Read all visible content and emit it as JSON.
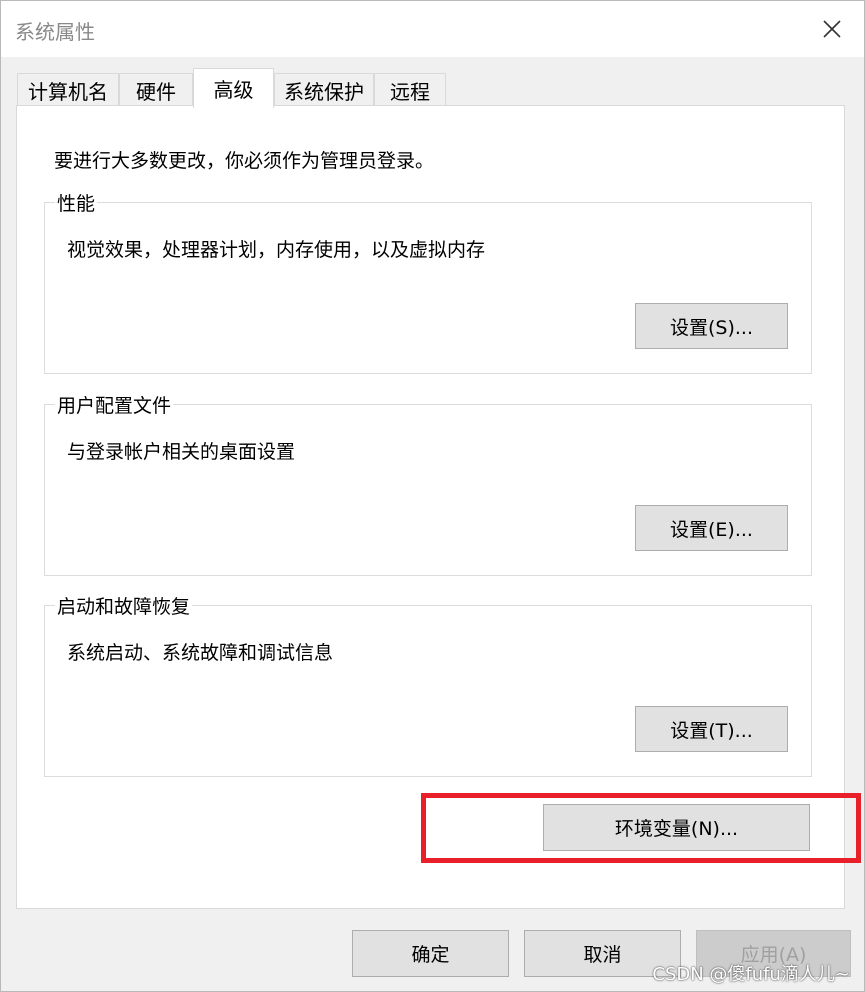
{
  "window": {
    "title": "系统属性"
  },
  "tabs": [
    {
      "label": "计算机名"
    },
    {
      "label": "硬件"
    },
    {
      "label": "高级"
    },
    {
      "label": "系统保护"
    },
    {
      "label": "远程"
    }
  ],
  "active_tab": "高级",
  "advanced": {
    "admin_note": "要进行大多数更改，你必须作为管理员登录。",
    "performance": {
      "title": "性能",
      "description": "视觉效果，处理器计划，内存使用，以及虚拟内存",
      "button": "设置(S)..."
    },
    "user_profiles": {
      "title": "用户配置文件",
      "description": "与登录帐户相关的桌面设置",
      "button": "设置(E)..."
    },
    "startup_recovery": {
      "title": "启动和故障恢复",
      "description": "系统启动、系统故障和调试信息",
      "button": "设置(T)..."
    },
    "env_button": "环境变量(N)..."
  },
  "footer": {
    "ok": "确定",
    "cancel": "取消",
    "apply": "应用(A)"
  },
  "watermark": "CSDN @傻fufu滴人儿~",
  "colors": {
    "highlight": "#e8202a",
    "tab_active_bg": "#ffffff",
    "button_bg": "#e1e1e1"
  }
}
